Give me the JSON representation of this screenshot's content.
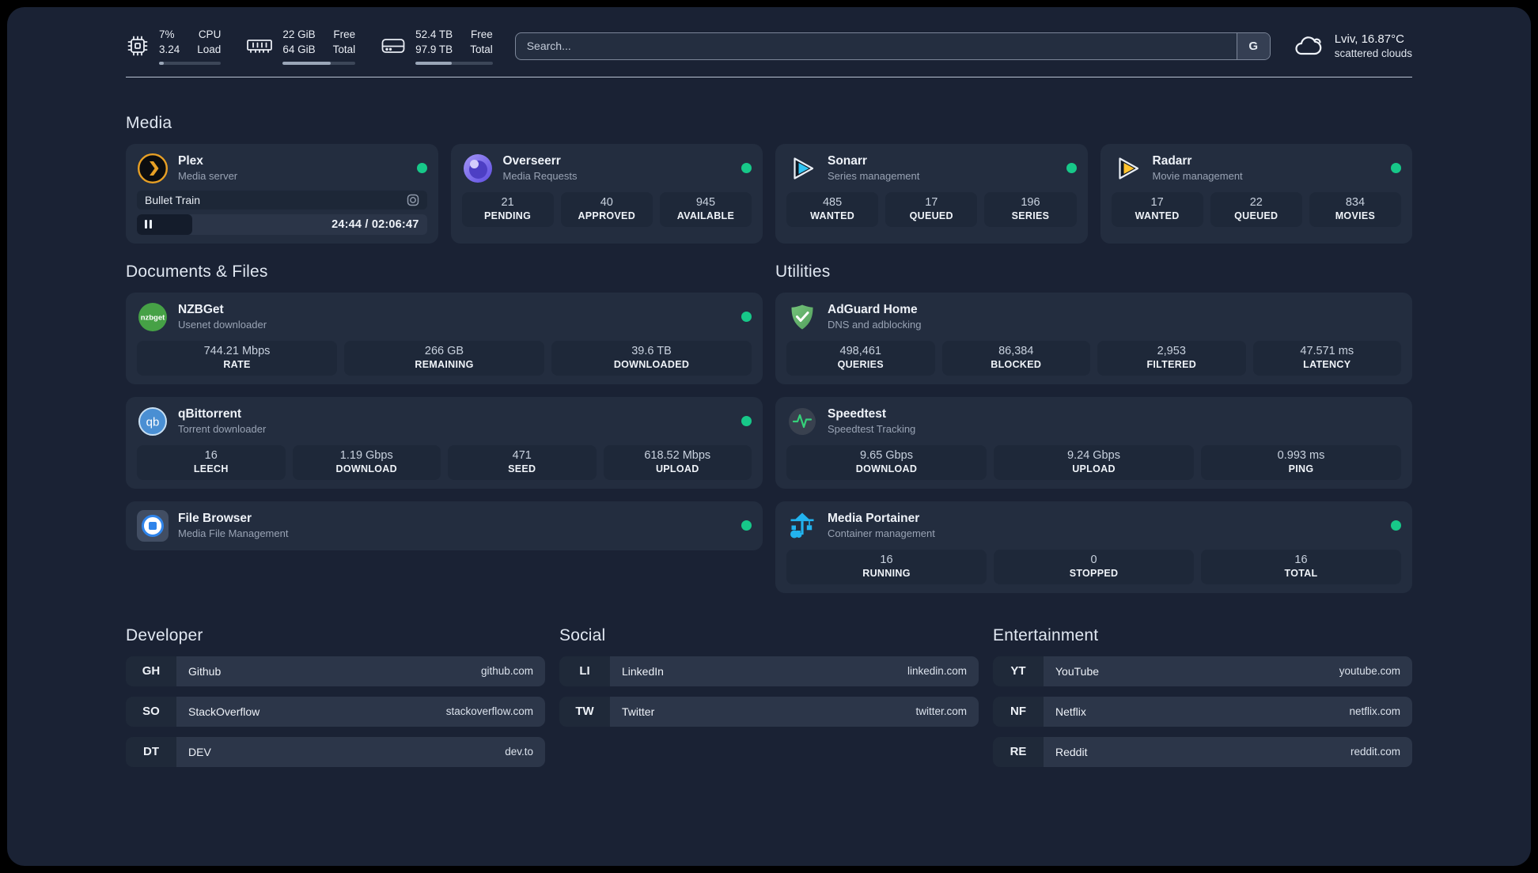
{
  "header": {
    "stats": [
      {
        "icon": "cpu-icon",
        "col1": [
          "7%",
          "3.24"
        ],
        "col2": [
          "CPU",
          "Load"
        ],
        "progress": 8
      },
      {
        "icon": "ram-icon",
        "col1": [
          "22 GiB",
          "64 GiB"
        ],
        "col2": [
          "Free",
          "Total"
        ],
        "progress": 66
      },
      {
        "icon": "disk-icon",
        "col1": [
          "52.4 TB",
          "97.9 TB"
        ],
        "col2": [
          "Free",
          "Total"
        ],
        "progress": 47
      }
    ],
    "search": {
      "placeholder": "Search...",
      "button": "G"
    },
    "weather": {
      "icon": "cloud-icon",
      "location_temp": "Lviv, 16.87°C",
      "condition": "scattered clouds"
    }
  },
  "media": {
    "title": "Media",
    "apps": [
      {
        "icon": "plex-icon",
        "name": "Plex",
        "subtitle": "Media server",
        "status_color": "#17c889",
        "player": {
          "title": "Bullet Train",
          "time": "24:44 / 02:06:47",
          "progress": 19
        }
      },
      {
        "icon": "overseerr-icon",
        "name": "Overseerr",
        "subtitle": "Media Requests",
        "status_color": "#17c889",
        "stats": [
          {
            "value": "21",
            "label": "PENDING"
          },
          {
            "value": "40",
            "label": "APPROVED"
          },
          {
            "value": "945",
            "label": "AVAILABLE"
          }
        ]
      },
      {
        "icon": "sonarr-icon",
        "name": "Sonarr",
        "subtitle": "Series management",
        "status_color": "#17c889",
        "stats": [
          {
            "value": "485",
            "label": "WANTED"
          },
          {
            "value": "17",
            "label": "QUEUED"
          },
          {
            "value": "196",
            "label": "SERIES"
          }
        ]
      },
      {
        "icon": "radarr-icon",
        "name": "Radarr",
        "subtitle": "Movie management",
        "status_color": "#17c889",
        "stats": [
          {
            "value": "17",
            "label": "WANTED"
          },
          {
            "value": "22",
            "label": "QUEUED"
          },
          {
            "value": "834",
            "label": "MOVIES"
          }
        ]
      }
    ]
  },
  "documents": {
    "title": "Documents & Files",
    "apps": [
      {
        "icon": "nzbget-icon",
        "name": "NZBGet",
        "subtitle": "Usenet downloader",
        "status_color": "#17c889",
        "stats": [
          {
            "value": "744.21 Mbps",
            "label": "RATE"
          },
          {
            "value": "266 GB",
            "label": "REMAINING"
          },
          {
            "value": "39.6 TB",
            "label": "DOWNLOADED"
          }
        ]
      },
      {
        "icon": "qbittorrent-icon",
        "name": "qBittorrent",
        "subtitle": "Torrent downloader",
        "status_color": "#17c889",
        "stats": [
          {
            "value": "16",
            "label": "LEECH"
          },
          {
            "value": "1.19 Gbps",
            "label": "DOWNLOAD"
          },
          {
            "value": "471",
            "label": "SEED"
          },
          {
            "value": "618.52 Mbps",
            "label": "UPLOAD"
          }
        ]
      },
      {
        "icon": "filebrowser-icon",
        "name": "File Browser",
        "subtitle": "Media File Management",
        "status_color": "#17c889"
      }
    ]
  },
  "utilities": {
    "title": "Utilities",
    "apps": [
      {
        "icon": "adguard-icon",
        "name": "AdGuard Home",
        "subtitle": "DNS and adblocking",
        "stats": [
          {
            "value": "498,461",
            "label": "QUERIES"
          },
          {
            "value": "86,384",
            "label": "BLOCKED"
          },
          {
            "value": "2,953",
            "label": "FILTERED"
          },
          {
            "value": "47.571 ms",
            "label": "LATENCY"
          }
        ]
      },
      {
        "icon": "speedtest-icon",
        "name": "Speedtest",
        "subtitle": "Speedtest Tracking",
        "stats": [
          {
            "value": "9.65 Gbps",
            "label": "DOWNLOAD"
          },
          {
            "value": "9.24 Gbps",
            "label": "UPLOAD"
          },
          {
            "value": "0.993 ms",
            "label": "PING"
          }
        ]
      },
      {
        "icon": "portainer-icon",
        "name": "Media Portainer",
        "subtitle": "Container management",
        "status_color": "#17c889",
        "stats": [
          {
            "value": "16",
            "label": "RUNNING"
          },
          {
            "value": "0",
            "label": "STOPPED"
          },
          {
            "value": "16",
            "label": "TOTAL"
          }
        ]
      }
    ]
  },
  "bookmarks": {
    "groups": [
      {
        "title": "Developer",
        "links": [
          {
            "abbr": "GH",
            "name": "Github",
            "url": "github.com"
          },
          {
            "abbr": "SO",
            "name": "StackOverflow",
            "url": "stackoverflow.com"
          },
          {
            "abbr": "DT",
            "name": "DEV",
            "url": "dev.to"
          }
        ]
      },
      {
        "title": "Social",
        "links": [
          {
            "abbr": "LI",
            "name": "LinkedIn",
            "url": "linkedin.com"
          },
          {
            "abbr": "TW",
            "name": "Twitter",
            "url": "twitter.com"
          }
        ]
      },
      {
        "title": "Entertainment",
        "links": [
          {
            "abbr": "YT",
            "name": "YouTube",
            "url": "youtube.com"
          },
          {
            "abbr": "NF",
            "name": "Netflix",
            "url": "netflix.com"
          },
          {
            "abbr": "RE",
            "name": "Reddit",
            "url": "reddit.com"
          }
        ]
      }
    ]
  }
}
